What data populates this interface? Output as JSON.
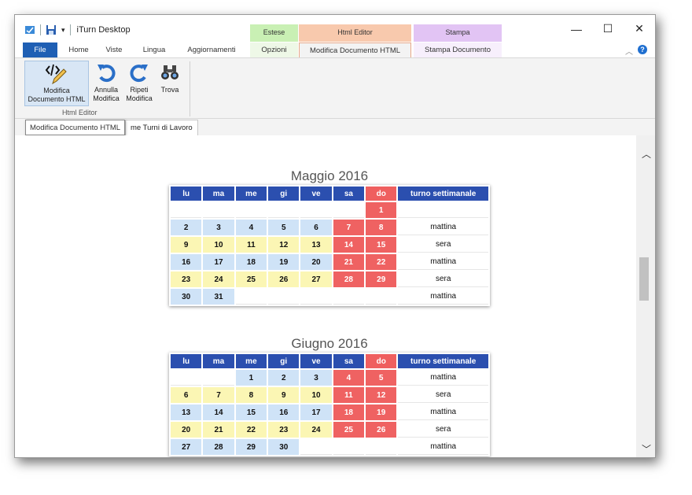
{
  "app": {
    "title": "iTurn Desktop"
  },
  "window_buttons": {
    "minimize": "—",
    "maximize": "☐",
    "close": "✕"
  },
  "context_groups": {
    "estese": "Estese",
    "html_editor": "Html Editor",
    "stampa": "Stampa"
  },
  "tabs": {
    "file": "File",
    "home": "Home",
    "viste": "Viste",
    "lingua": "Lingua",
    "aggiornamenti": "Aggiornamenti",
    "opzioni": "Opzioni",
    "modifica_html": "Modifica Documento HTML",
    "stampa_documento": "Stampa Documento"
  },
  "help": "?",
  "ribbon": {
    "buttons": [
      {
        "label1": "Modifica",
        "label2": "Documento HTML",
        "icon": "code-edit-icon"
      },
      {
        "label1": "Annulla",
        "label2": "Modifica",
        "icon": "undo-icon"
      },
      {
        "label1": "Ripeti",
        "label2": "Modifica",
        "icon": "redo-icon"
      },
      {
        "label1": "Trova",
        "label2": "",
        "icon": "binoculars-icon"
      }
    ],
    "group_label": "Html Editor"
  },
  "doc_tab": "me Turni di Lavoro",
  "tooltip": "Modifica Documento HTML",
  "calendar_headers": [
    "lu",
    "ma",
    "me",
    "gi",
    "ve",
    "sa",
    "do",
    "turno settimanale"
  ],
  "months": [
    {
      "title": "Maggio 2016",
      "weeks": [
        {
          "days": [
            "",
            "",
            "",
            "",
            "",
            "",
            "1"
          ],
          "turno": ""
        },
        {
          "days": [
            "2",
            "3",
            "4",
            "5",
            "6",
            "7",
            "8"
          ],
          "turno": "mattina"
        },
        {
          "days": [
            "9",
            "10",
            "11",
            "12",
            "13",
            "14",
            "15"
          ],
          "turno": "sera"
        },
        {
          "days": [
            "16",
            "17",
            "18",
            "19",
            "20",
            "21",
            "22"
          ],
          "turno": "mattina"
        },
        {
          "days": [
            "23",
            "24",
            "25",
            "26",
            "27",
            "28",
            "29"
          ],
          "turno": "sera"
        },
        {
          "days": [
            "30",
            "31",
            "",
            "",
            "",
            "",
            ""
          ],
          "turno": "mattina"
        }
      ]
    },
    {
      "title": "Giugno 2016",
      "weeks": [
        {
          "days": [
            "",
            "",
            "1",
            "2",
            "3",
            "4",
            "5"
          ],
          "turno": "mattina"
        },
        {
          "days": [
            "6",
            "7",
            "8",
            "9",
            "10",
            "11",
            "12"
          ],
          "turno": "sera"
        },
        {
          "days": [
            "13",
            "14",
            "15",
            "16",
            "17",
            "18",
            "19"
          ],
          "turno": "mattina"
        },
        {
          "days": [
            "20",
            "21",
            "22",
            "23",
            "24",
            "25",
            "26"
          ],
          "turno": "sera"
        },
        {
          "days": [
            "27",
            "28",
            "29",
            "30",
            "",
            "",
            ""
          ],
          "turno": "mattina"
        }
      ]
    }
  ],
  "colors": {
    "header_blue": "#2b4faf",
    "sunday_red": "#ef5f5f",
    "morning_blue": "#cfe3f7",
    "evening_yellow": "#fbf6b4",
    "file_tab": "#1f5fb4"
  }
}
